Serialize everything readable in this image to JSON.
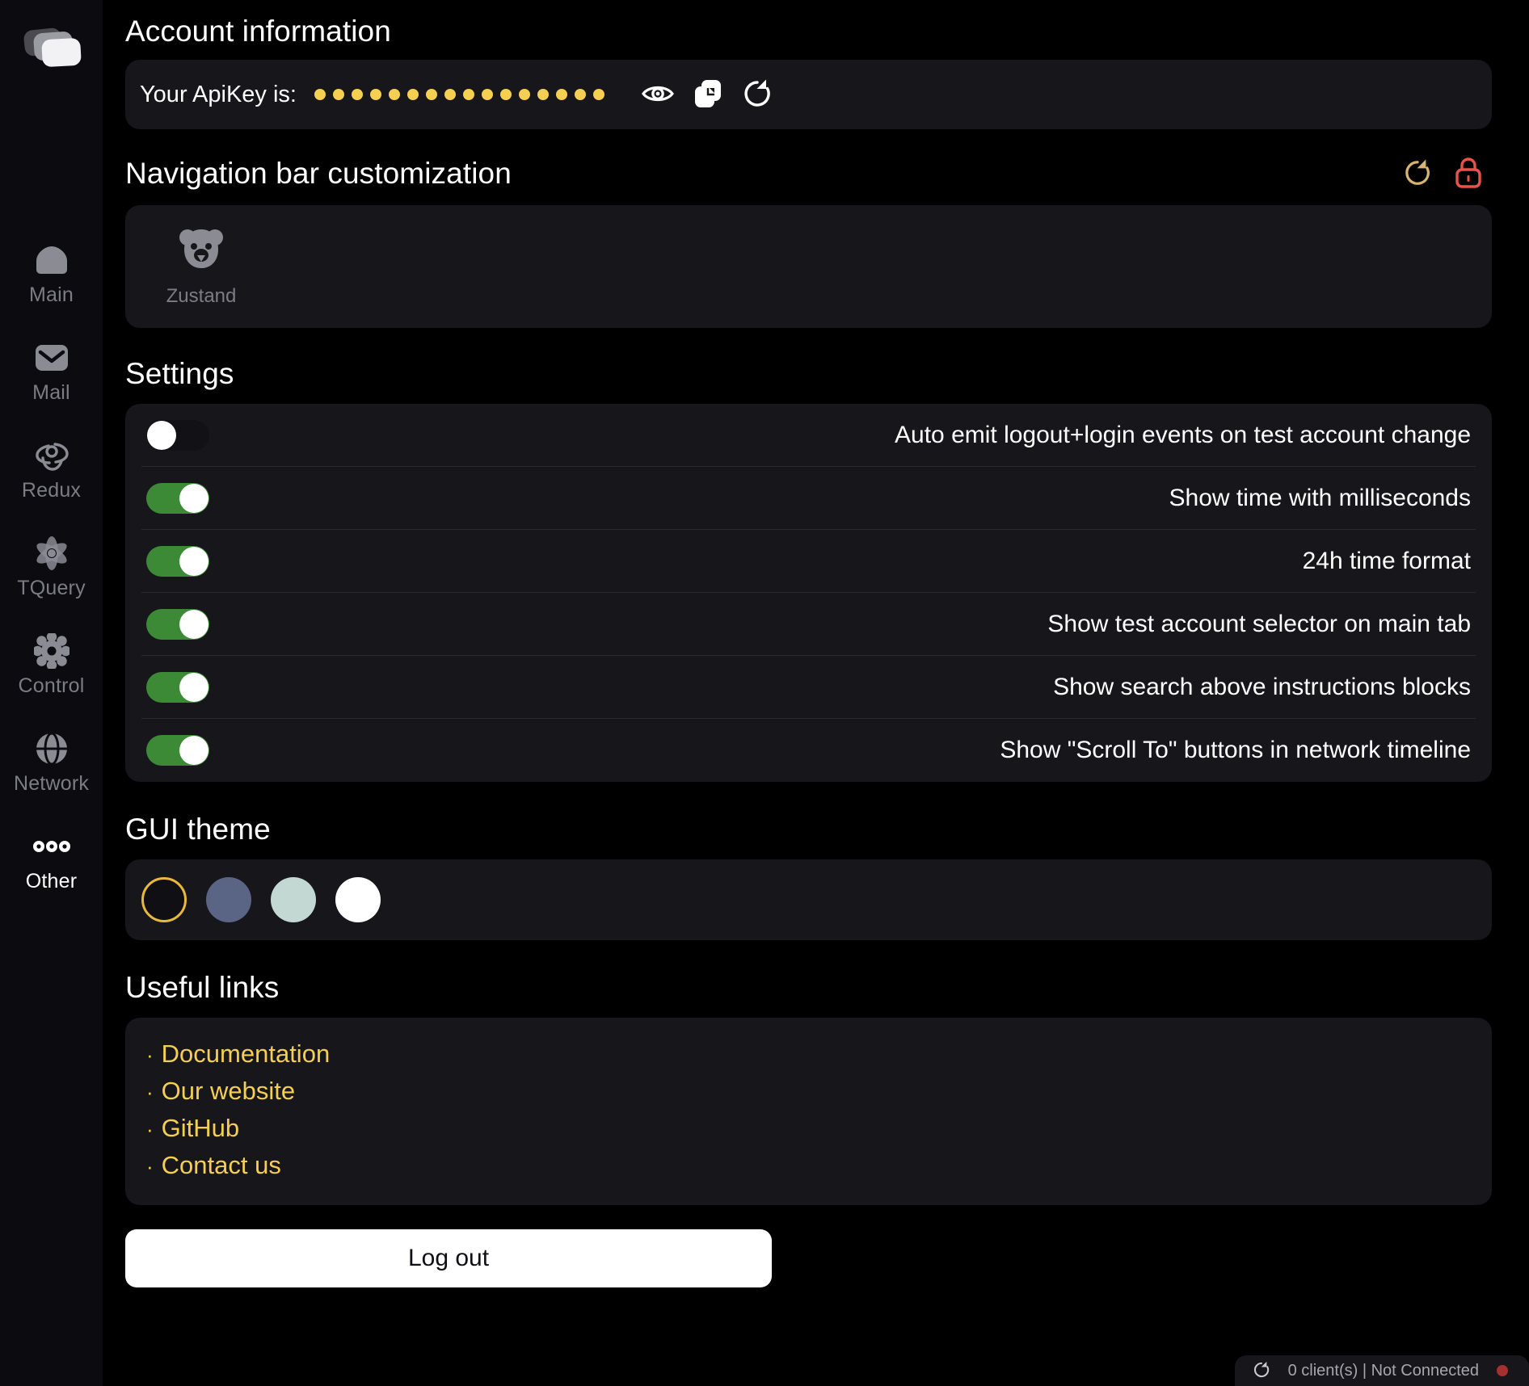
{
  "sidebar": {
    "logo_name": "app-logo",
    "items": [
      {
        "label": "Main",
        "icon": "home-icon",
        "active": false
      },
      {
        "label": "Mail",
        "icon": "mail-icon",
        "active": false
      },
      {
        "label": "Redux",
        "icon": "redux-icon",
        "active": false
      },
      {
        "label": "TQuery",
        "icon": "react-query-icon",
        "active": false
      },
      {
        "label": "Control",
        "icon": "gear-icon",
        "active": false
      },
      {
        "label": "Network",
        "icon": "globe-icon",
        "active": false
      },
      {
        "label": "Other",
        "icon": "dots-icon",
        "active": true
      }
    ]
  },
  "account": {
    "title": "Account information",
    "apikey_label": "Your ApiKey is:",
    "apikey_masked_dots": 16,
    "apikey_mask_color": "#f4cf52",
    "actions": [
      {
        "name": "reveal-apikey-button",
        "icon": "eye-icon"
      },
      {
        "name": "copy-apikey-button",
        "icon": "copy-icon"
      },
      {
        "name": "regenerate-apikey-button",
        "icon": "refresh-icon"
      }
    ]
  },
  "navbar_customization": {
    "title": "Navigation bar customization",
    "reset_icon_color": "#d9b470",
    "lock_icon_color": "#e8534a",
    "chips": [
      {
        "label": "Zustand",
        "icon": "bear-icon"
      }
    ]
  },
  "settings": {
    "title": "Settings",
    "rows": [
      {
        "label": "Auto emit logout+login events on test account change",
        "on": false
      },
      {
        "label": "Show time with milliseconds",
        "on": true
      },
      {
        "label": "24h time format",
        "on": true
      },
      {
        "label": "Show test account selector on main tab",
        "on": true
      },
      {
        "label": "Show search above instructions blocks",
        "on": true
      },
      {
        "label": "Show \"Scroll To\" buttons in network timeline",
        "on": true
      }
    ],
    "toggle_on_color": "#3d8a36",
    "toggle_off_color": "#111116"
  },
  "gui_theme": {
    "title": "GUI theme",
    "swatches": [
      {
        "name": "theme-dark",
        "color": "#0f0f14",
        "selected": true
      },
      {
        "name": "theme-slate",
        "color": "#5a6585",
        "selected": false
      },
      {
        "name": "theme-mint",
        "color": "#c3d8d2",
        "selected": false
      },
      {
        "name": "theme-light",
        "color": "#ffffff",
        "selected": false
      }
    ],
    "selected_ring_color": "#e8b93a"
  },
  "useful_links": {
    "title": "Useful links",
    "bullet": "·",
    "items": [
      {
        "label": "Documentation"
      },
      {
        "label": "Our website"
      },
      {
        "label": "GitHub"
      },
      {
        "label": "Contact us"
      }
    ],
    "link_color": "#f4cf52"
  },
  "logout": {
    "label": "Log out"
  },
  "statusbar": {
    "refresh_icon": "refresh-icon",
    "text": "0 client(s) | Not Connected",
    "indicator_color": "#a63030"
  }
}
